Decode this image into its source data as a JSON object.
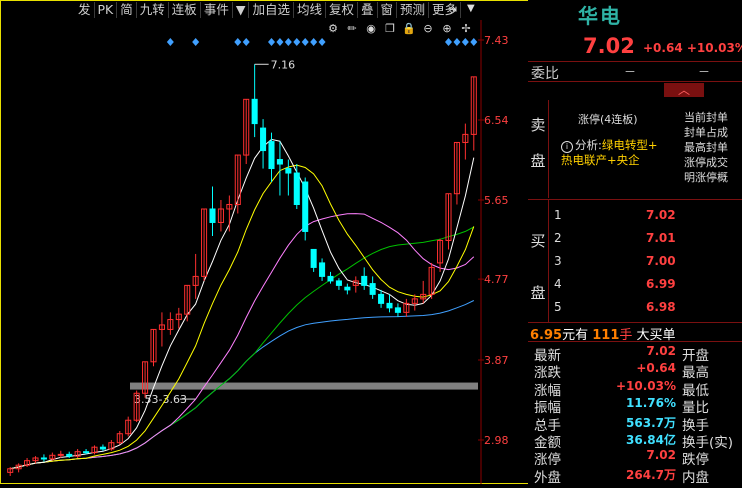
{
  "toolbar": {
    "items": [
      "发",
      "PK",
      "简",
      "九转",
      "连板",
      "事件",
      "▼",
      "加自选",
      "均线",
      "复权",
      "叠",
      "窗",
      "预测",
      "更多"
    ]
  },
  "chart": {
    "price_axis": [
      "7.43",
      "6.54",
      "5.65",
      "4.77",
      "3.87",
      "2.98"
    ],
    "high_label": "7.16",
    "low_label": "3.53-3.63",
    "colors": {
      "up": "#ff3030",
      "down": "#00ffff",
      "axis": "#8b0000",
      "ma5": "#ffffff",
      "ma10": "#ffff00",
      "ma20": "#ff80ff",
      "ma30": "#00c000",
      "ma60": "#40a0ff"
    }
  },
  "chart_data": {
    "type": "candlestick",
    "ylim": [
      2.7,
      7.5
    ],
    "candles": [
      [
        2.62,
        2.66,
        2.58,
        2.68
      ],
      [
        2.66,
        2.7,
        2.62,
        2.72
      ],
      [
        2.7,
        2.75,
        2.68,
        2.78
      ],
      [
        2.75,
        2.78,
        2.72,
        2.8
      ],
      [
        2.78,
        2.77,
        2.74,
        2.82
      ],
      [
        2.77,
        2.81,
        2.75,
        2.84
      ],
      [
        2.81,
        2.82,
        2.78,
        2.86
      ],
      [
        2.82,
        2.8,
        2.78,
        2.85
      ],
      [
        2.8,
        2.85,
        2.78,
        2.88
      ],
      [
        2.85,
        2.84,
        2.82,
        2.88
      ],
      [
        2.84,
        2.9,
        2.82,
        2.92
      ],
      [
        2.9,
        2.88,
        2.86,
        2.93
      ],
      [
        2.88,
        2.95,
        2.86,
        2.98
      ],
      [
        2.95,
        3.05,
        2.93,
        3.08
      ],
      [
        3.05,
        3.2,
        3.02,
        3.24
      ],
      [
        3.2,
        3.5,
        3.18,
        3.53
      ],
      [
        3.5,
        3.85,
        3.45,
        3.85
      ],
      [
        3.85,
        4.21,
        3.8,
        4.21
      ],
      [
        4.21,
        4.26,
        4.02,
        4.4
      ],
      [
        4.21,
        4.32,
        4.15,
        4.4
      ],
      [
        4.32,
        4.38,
        4.22,
        4.45
      ],
      [
        4.38,
        4.7,
        4.3,
        4.7
      ],
      [
        4.7,
        4.8,
        4.55,
        5.05
      ],
      [
        4.8,
        5.55,
        4.75,
        5.55
      ],
      [
        5.55,
        5.4,
        5.25,
        5.8
      ],
      [
        5.4,
        5.55,
        5.3,
        5.65
      ],
      [
        5.55,
        5.6,
        5.3,
        5.7
      ],
      [
        5.6,
        6.15,
        5.5,
        6.15
      ],
      [
        6.15,
        6.77,
        6.05,
        6.77
      ],
      [
        6.77,
        6.5,
        6.35,
        7.16
      ],
      [
        6.45,
        6.2,
        6.0,
        6.55
      ],
      [
        6.3,
        6.0,
        5.85,
        6.4
      ],
      [
        6.1,
        6.05,
        5.7,
        6.3
      ],
      [
        6.0,
        5.95,
        5.7,
        6.1
      ],
      [
        5.95,
        5.6,
        5.55,
        6.05
      ],
      [
        5.85,
        5.3,
        5.2,
        5.9
      ],
      [
        5.1,
        4.9,
        4.85,
        5.1
      ],
      [
        4.95,
        4.8,
        4.75,
        5.0
      ],
      [
        4.8,
        4.75,
        4.72,
        4.85
      ],
      [
        4.75,
        4.7,
        4.65,
        4.78
      ],
      [
        4.68,
        4.65,
        4.6,
        4.72
      ],
      [
        4.7,
        4.75,
        4.62,
        4.8
      ],
      [
        4.8,
        4.7,
        4.65,
        4.9
      ],
      [
        4.72,
        4.6,
        4.55,
        4.8
      ],
      [
        4.6,
        4.5,
        4.45,
        4.65
      ],
      [
        4.5,
        4.45,
        4.4,
        4.6
      ],
      [
        4.45,
        4.4,
        4.35,
        4.5
      ],
      [
        4.4,
        4.5,
        4.35,
        4.55
      ],
      [
        4.5,
        4.55,
        4.42,
        4.6
      ],
      [
        4.55,
        4.6,
        4.5,
        4.75
      ],
      [
        4.6,
        4.9,
        4.55,
        4.95
      ],
      [
        4.95,
        5.2,
        4.85,
        5.22
      ],
      [
        5.2,
        5.72,
        5.1,
        5.72
      ],
      [
        5.72,
        6.29,
        5.6,
        6.29
      ],
      [
        6.29,
        6.38,
        6.1,
        6.5
      ],
      [
        6.38,
        7.02,
        6.2,
        7.02
      ]
    ]
  },
  "rpanel": {
    "stock_name": "华电",
    "price": "7.02",
    "change": "+0.64",
    "change_pct": "+10.03%",
    "weibi_label": "委比",
    "weibi_v1": "－",
    "weibi_v2": "－",
    "sell_label": [
      "卖",
      "盘"
    ],
    "zt_title": "涨停(4连板)",
    "analysis_prefix": "分析:",
    "analysis_hl1": "绿电转型+",
    "analysis_hl2": "热电联产+央企",
    "fengdan": [
      "当前封单",
      "封单占成",
      "最高封单",
      "涨停成交",
      "明涨停概"
    ],
    "buy_label": [
      "买",
      "盘"
    ],
    "buy": [
      {
        "n": "1",
        "p": "7.02"
      },
      {
        "n": "2",
        "p": "7.01"
      },
      {
        "n": "3",
        "p": "7.00"
      },
      {
        "n": "4",
        "p": "6.99"
      },
      {
        "n": "5",
        "p": "6.98"
      }
    ],
    "deal_price": "6.95",
    "deal_unit": "元有",
    "deal_vol": "111",
    "deal_hand": "手",
    "deal_tag": "大买单",
    "quotes": [
      {
        "l": "最新",
        "v": "7.02",
        "l2": "开盘",
        "c": "red"
      },
      {
        "l": "涨跌",
        "v": "+0.64",
        "l2": "最高",
        "c": "red"
      },
      {
        "l": "涨幅",
        "v": "+10.03%",
        "l2": "最低",
        "c": "red"
      },
      {
        "l": "振幅",
        "v": "11.76%",
        "l2": "量比",
        "c": "cyan"
      },
      {
        "l": "总手",
        "v": "563.7万",
        "l2": "换手",
        "c": "cyan"
      },
      {
        "l": "金额",
        "v": "36.84亿",
        "l2": "换手(实)",
        "c": "cyan"
      },
      {
        "l": "涨停",
        "v": "7.02",
        "l2": "跌停",
        "c": "red"
      },
      {
        "l": "外盘",
        "v": "264.7万",
        "l2": "内盘",
        "c": "red"
      }
    ]
  }
}
